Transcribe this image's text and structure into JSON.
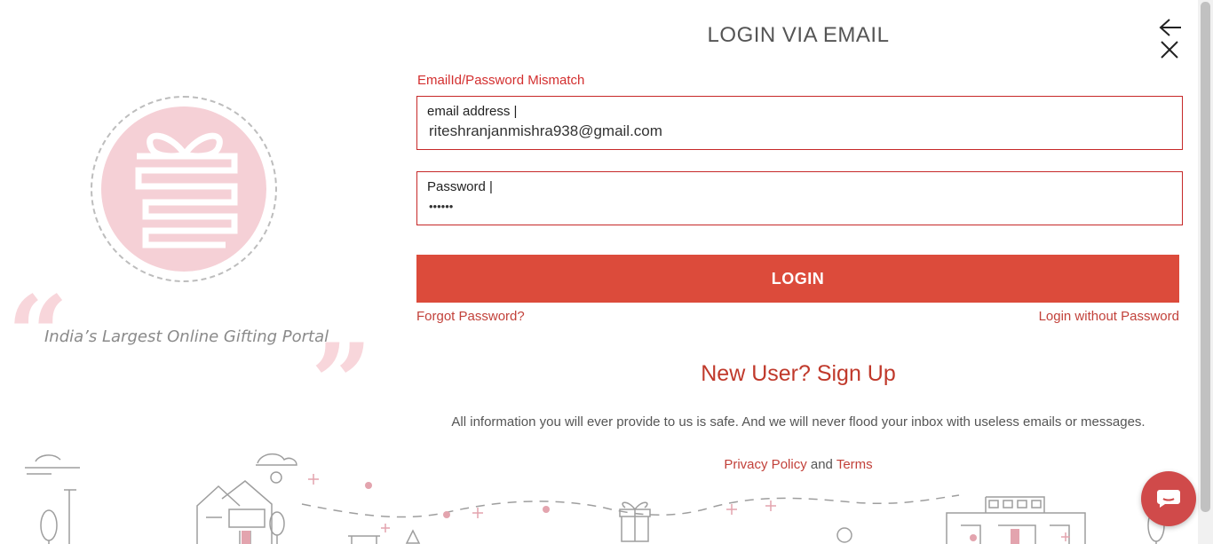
{
  "brand": {
    "tagline": "India’s Largest Online Gifting Portal",
    "quote_open": "“",
    "quote_close": "”",
    "logo_icon": "gift-box-icon"
  },
  "modal": {
    "title": "LOGIN VIA EMAIL",
    "error": "EmailId/Password Mismatch",
    "back_icon": "arrow-left-icon",
    "close_icon": "close-icon"
  },
  "form": {
    "email_label": "email address |",
    "email_value": "riteshranjanmishra938@gmail.com",
    "password_label": "Password |",
    "password_value": "••••••",
    "login_label": "LOGIN",
    "forgot_label": "Forgot Password?",
    "no_password_label": "Login without Password"
  },
  "signup": {
    "label": "New User? Sign Up"
  },
  "footer": {
    "info": "All information you will ever provide to us is safe. And we will never flood your inbox with useless emails or messages.",
    "privacy": "Privacy Policy",
    "and": "and",
    "terms": "Terms"
  },
  "colors": {
    "accent": "#dc4b3b",
    "error": "#d32f2f",
    "link": "#c2413a",
    "logo_fill": "#f5d0d6"
  },
  "chat": {
    "icon": "chat-icon"
  }
}
